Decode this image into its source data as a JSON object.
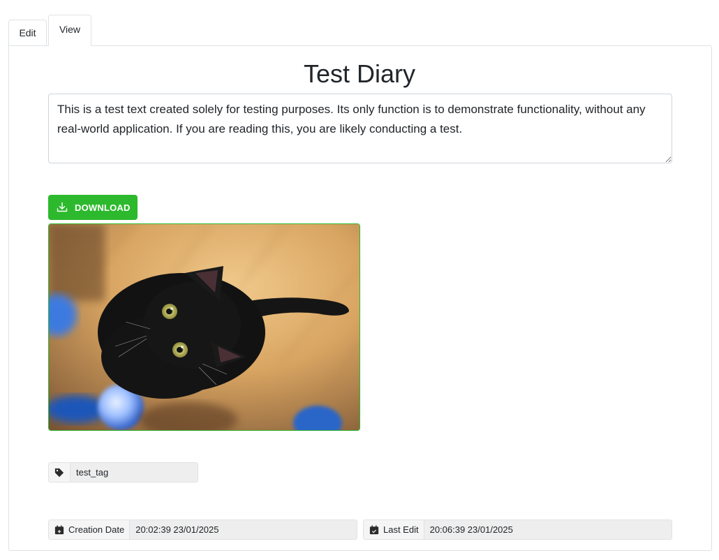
{
  "tabs": [
    {
      "label": "Edit",
      "active": false
    },
    {
      "label": "View",
      "active": true
    }
  ],
  "title": "Test Diary",
  "body_text": "This is a test text created solely for testing purposes. Its only function is to demonstrate functionality, without any real-world application. If you are reading this, you are likely conducting a test.",
  "download": {
    "label": "DOWNLOAD",
    "icon": "download-icon",
    "color": "#2db92d"
  },
  "image": {
    "subject": "black cat looking up"
  },
  "tag": {
    "icon": "tag-icon",
    "value": "test_tag"
  },
  "creation": {
    "label": "Creation Date",
    "icon": "calendar-plus-icon",
    "value": "20:02:39 23/01/2025"
  },
  "last_edit": {
    "label": "Last Edit",
    "icon": "calendar-check-icon",
    "value": "20:06:39 23/01/2025"
  }
}
